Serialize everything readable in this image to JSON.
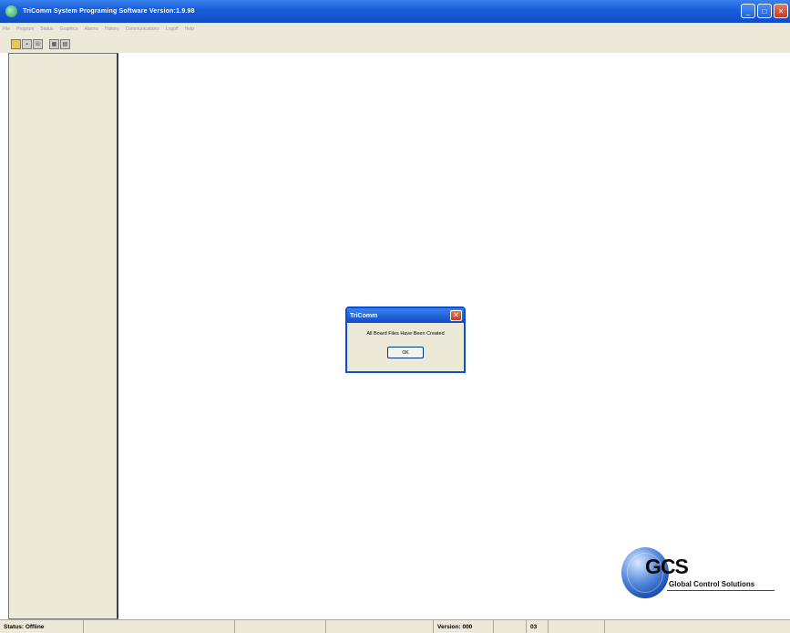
{
  "window": {
    "title": "TriComm System Programing Software  Version:1.9.98"
  },
  "menu": [
    {
      "label": "File"
    },
    {
      "label": "Program"
    },
    {
      "label": "Status"
    },
    {
      "label": "Graphics"
    },
    {
      "label": "Alarms"
    },
    {
      "label": "History"
    },
    {
      "label": "Communications"
    },
    {
      "label": "Logoff"
    },
    {
      "label": "Help"
    }
  ],
  "toolbar": {
    "icons": [
      "open-folder-icon",
      "save-icon",
      "network-icon",
      "grid-icon",
      "window-icon"
    ]
  },
  "dialog": {
    "title": "TriComm",
    "message": "All Board Files Have Been Created",
    "ok_label": "OK",
    "close_glyph": "✕"
  },
  "logo": {
    "name": "GCS",
    "subtitle": "Global Control Solutions"
  },
  "statusbar": {
    "status": "Status: Offline",
    "version": "Version: 000",
    "code": "03"
  }
}
